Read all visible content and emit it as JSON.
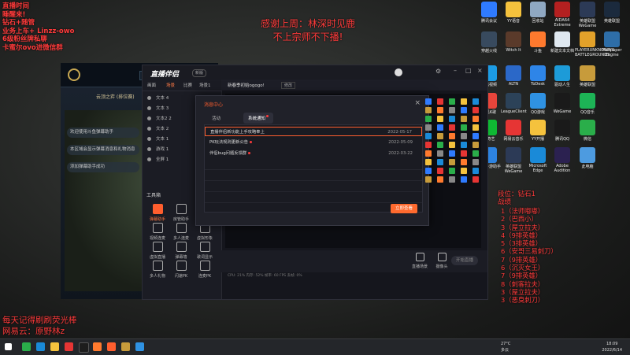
{
  "overlay": {
    "stream_info": [
      "直播时间",
      "睡醒来!",
      "钻石+随管",
      "业务上车+ Linzz-owo",
      "6级粉丝牌私聊",
      "卡蜜尔ovo进微信群"
    ],
    "thanks": [
      "感谢上周：林深时见鹿",
      "不上宗师不下播!"
    ],
    "bottom": [
      "每天记得刷刷荧光棒",
      "网易云：原野林z"
    ],
    "rank": [
      "段位：钻石1",
      "战绩"
    ],
    "records": [
      "1（法师嘟嘟）",
      "2（巴西小）",
      "3（屋立拉夫）",
      "4（9排英雄）",
      "5（3排英雄）",
      "6（安哥三易刺刀）",
      "7（9排英雄）",
      "6（沉灭女王）",
      "7（9排英雄）",
      "8（刺客拉夫）",
      "3（屋立拉夫）",
      "3（恶臭刺刀）"
    ]
  },
  "game_client": {
    "title": "云顶之弈 (排位赛)",
    "side_messages": [
      "欢迎使用斗鱼弹幕助手",
      "本区域会显示弹幕消息和礼物消息",
      "添加弹幕助手成功"
    ]
  },
  "app": {
    "brand": "直播伴侣",
    "brand_badge": "新版",
    "tabs": [
      "画面",
      "场景",
      "比赛",
      "场景1"
    ],
    "sources": [
      "文本 4",
      "文本 3",
      "文本2 2",
      "文本 2",
      "文本 1",
      "游戏 1",
      "全屏 1"
    ],
    "tools_title": "工具箱",
    "tools": [
      "弹幕助手",
      "房管助手",
      "视频连麦",
      "多人连麦",
      "虚拟形象",
      "虚拟直播",
      "弹幕墙",
      "歌词显示",
      "多人礼物",
      "闪速PK",
      "连麦PK",
      "更多"
    ],
    "main_title": "新春季初始ogogo!",
    "main_badge": "修改",
    "bottom_items": [
      "直播场景",
      "摄像头",
      "手机投屏",
      "投屏端",
      "麦克风",
      "扬声器"
    ],
    "start_button": "开始直播",
    "status": "CPU: 21%  内存: 52%  帧率: 60 FPS  丢帧: 0%"
  },
  "dialog": {
    "title": "消息中心",
    "tabs": [
      "活动",
      "系统通知"
    ],
    "messages": [
      {
        "title": "直播伴侣新功能上手攻略奉上",
        "date": "2022-05-17"
      },
      {
        "title": "PK玩法规则更新公告",
        "date": "2022-05-09"
      },
      {
        "title": "伴侣bug问题反馈群",
        "date": "2022-03-22"
      }
    ],
    "action_button": "立即查看"
  },
  "desktop_icons": [
    {
      "label": "腾讯会议",
      "color": "#2f7bff"
    },
    {
      "label": "YY语音",
      "color": "#f5c23d"
    },
    {
      "label": "回收站",
      "color": "#8fa8c2"
    },
    {
      "label": "AIDA64 Extreme",
      "color": "#b42020"
    },
    {
      "label": "英雄联盟WeGame",
      "color": "#2c3a56"
    },
    {
      "label": "英雄联盟",
      "color": "#1b2a3d"
    },
    {
      "label": "穿越火线",
      "color": "#384a5e"
    },
    {
      "label": "Witch It",
      "color": "#5a3a2a"
    },
    {
      "label": "斗鱼",
      "color": "#ff7a2e"
    },
    {
      "label": "新建文本文档",
      "color": "#dfe8f0"
    },
    {
      "label": "PLAYERUNKNOWN'S BATTLEGROUNDS",
      "color": "#e2a12a"
    },
    {
      "label": "Wallpaper Engine",
      "color": "#2e6ea8"
    },
    {
      "label": "腾讯视频",
      "color": "#1c9ce5"
    },
    {
      "label": "ALTN",
      "color": "#2b68c8"
    },
    {
      "label": "ToDesk",
      "color": "#2e85e8"
    },
    {
      "label": "驱动人生",
      "color": "#1d9bd8"
    },
    {
      "label": "英雄联盟",
      "color": "#c79b3b"
    },
    {
      "label": "全民K歌",
      "color": "#e8453b"
    },
    {
      "label": "LeagueClient",
      "color": "#2c4258"
    },
    {
      "label": "QQ游戏",
      "color": "#2f92e3"
    },
    {
      "label": "WeGame",
      "color": "#1a1a1a"
    },
    {
      "label": "QQ音乐",
      "color": "#1db456"
    },
    {
      "label": "爱奇艺",
      "color": "#0fb833"
    },
    {
      "label": "网易云音乐",
      "color": "#e63534"
    },
    {
      "label": "YY开播",
      "color": "#f5c23d"
    },
    {
      "label": "腾讯QQ",
      "color": "#1a1a1a"
    },
    {
      "label": "微信",
      "color": "#2aae4a"
    },
    {
      "label": "腾讯手游助手",
      "color": "#2d83e0"
    },
    {
      "label": "英雄联盟WeGame",
      "color": "#2c3a56"
    },
    {
      "label": "Microsoft Edge",
      "color": "#1a8ad8"
    },
    {
      "label": "Adobe Audition",
      "color": "#2b2150"
    },
    {
      "label": "此电脑",
      "color": "#4d9be0"
    }
  ],
  "taskbar": {
    "weather": [
      "27°C",
      "多云"
    ],
    "time": "18:09",
    "date": "2022/6/14"
  }
}
